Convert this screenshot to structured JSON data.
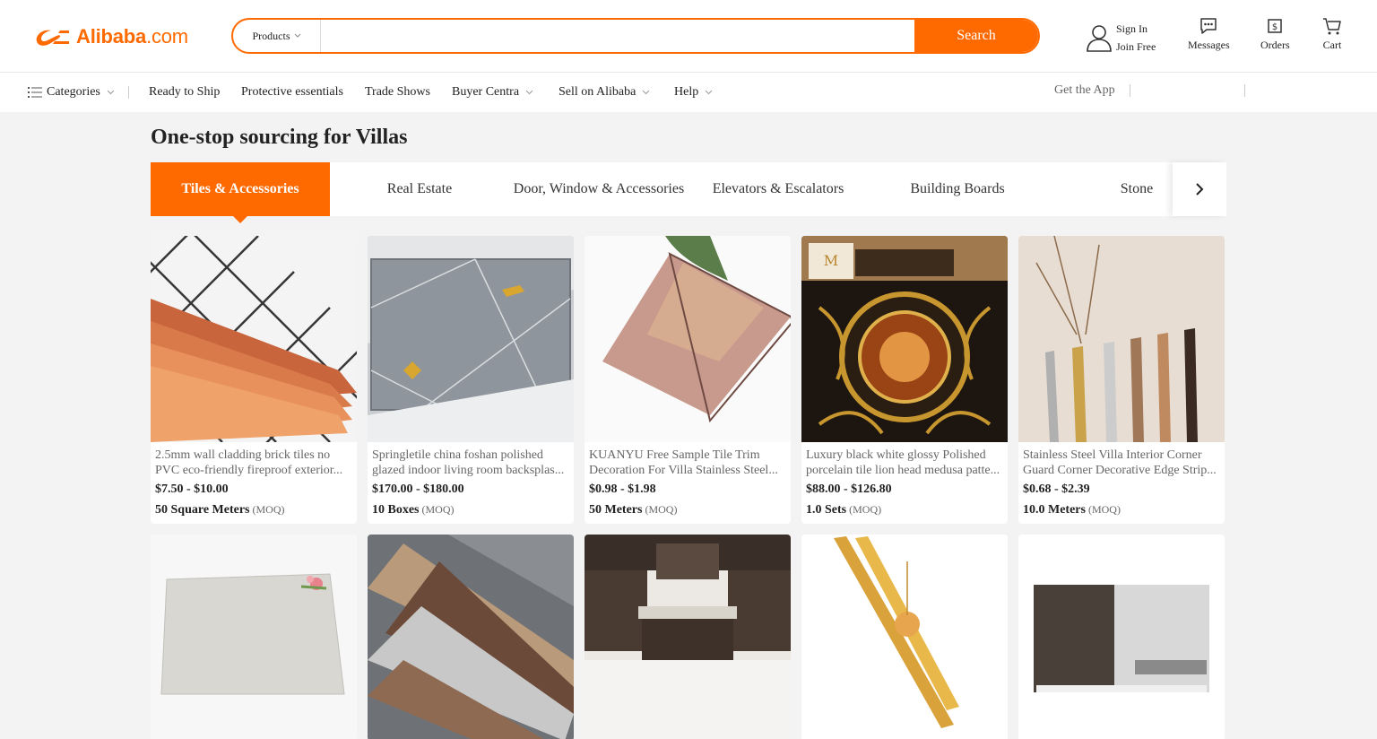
{
  "header": {
    "logo_brand": "Alibaba",
    "logo_suffix": ".com",
    "search_type": "Products",
    "search_placeholder": "",
    "search_button": "Search",
    "sign_in": "Sign In",
    "join_free": "Join Free",
    "messages": "Messages",
    "orders": "Orders",
    "cart": "Cart"
  },
  "nav": {
    "categories": "Categories",
    "items": [
      "Ready to Ship",
      "Protective essentials",
      "Trade Shows",
      "Buyer Centra",
      "Sell on Alibaba",
      "Help"
    ],
    "get_app": "Get the App"
  },
  "page": {
    "title": "One-stop sourcing for Villas"
  },
  "tabs": [
    "Tiles & Accessories",
    "Real Estate",
    "Door, Window & Accessories",
    "Elevators & Escalators",
    "Building Boards",
    "Stone"
  ],
  "active_tab": 0,
  "moq_label": "(MOQ)",
  "products": [
    {
      "title": "2.5mm wall cladding brick tiles no PVC eco-friendly fireproof exterior...",
      "price": "$7.50 - $10.00",
      "moq": "50 Square Meters"
    },
    {
      "title": "Springletile china foshan polished glazed indoor living room backsplas...",
      "price": "$170.00 - $180.00",
      "moq": "10 Boxes"
    },
    {
      "title": "KUANYU Free Sample Tile Trim Decoration For Villa Stainless Steel...",
      "price": "$0.98 - $1.98",
      "moq": "50 Meters"
    },
    {
      "title": "Luxury black white glossy Polished porcelain tile lion head medusa patte...",
      "price": "$88.00 - $126.80",
      "moq": "1.0 Sets"
    },
    {
      "title": "Stainless Steel Villa Interior Corner Guard Corner Decorative Edge Strip...",
      "price": "$0.68 - $2.39",
      "moq": "10.0 Meters"
    }
  ],
  "colors": {
    "accent": "#ff6a00"
  }
}
